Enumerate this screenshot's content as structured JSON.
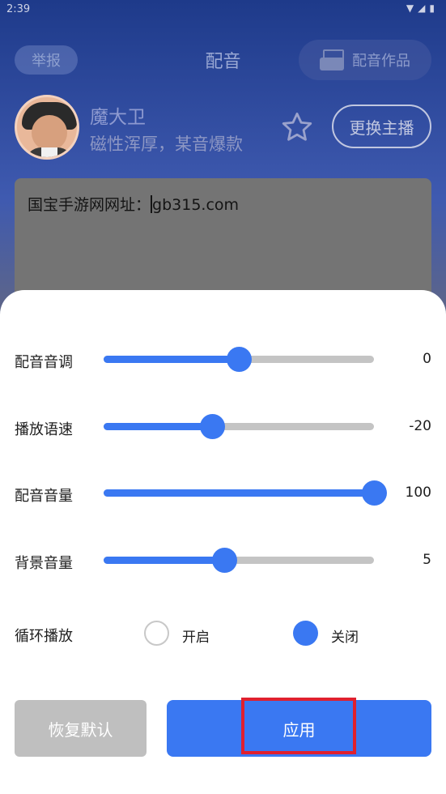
{
  "status_bar": {
    "time": "2:39"
  },
  "header": {
    "report_label": "举报",
    "title": "配音",
    "works_label": "配音作品"
  },
  "narrator": {
    "name": "魔大卫",
    "description": "磁性浑厚，某音爆款",
    "change_label": "更换主播"
  },
  "text_input": {
    "before_cursor": "国宝手游网网址：",
    "after_cursor": "gb315.com"
  },
  "settings": {
    "sliders": [
      {
        "label": "配音音调",
        "value": "0",
        "fraction": 0.5
      },
      {
        "label": "播放语速",
        "value": "-20",
        "fraction": 0.4
      },
      {
        "label": "配音音量",
        "value": "100",
        "fraction": 1.0
      },
      {
        "label": "背景音量",
        "value": "5",
        "fraction": 0.445
      }
    ],
    "loop": {
      "label": "循环播放",
      "options": [
        {
          "label": "开启",
          "selected": false
        },
        {
          "label": "关闭",
          "selected": true
        }
      ]
    }
  },
  "actions": {
    "reset_label": "恢复默认",
    "apply_label": "应用"
  },
  "colors": {
    "accent": "#3a78f2",
    "track": "#c4c4c4",
    "highlight": "#e0202e"
  }
}
